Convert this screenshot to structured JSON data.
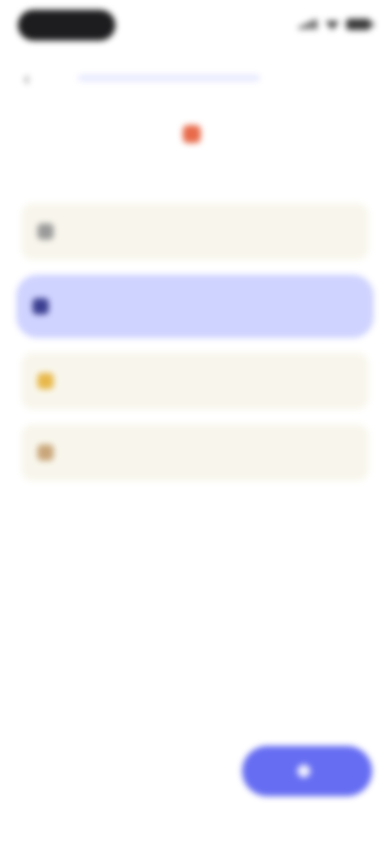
{
  "status_bar": {
    "icons": [
      "signal-icon",
      "wifi-icon",
      "battery-icon"
    ]
  },
  "nav": {
    "back_icon": "chevron-left-icon",
    "progress_fraction": 0.0
  },
  "question": {
    "line1": "",
    "line2": "",
    "icon": "emoji-icon"
  },
  "options": [
    {
      "label": "",
      "selected": false,
      "icon": "option-icon"
    },
    {
      "label": "",
      "selected": true,
      "icon": "option-icon"
    },
    {
      "label": "",
      "selected": false,
      "icon": "option-icon"
    },
    {
      "label": "",
      "selected": false,
      "icon": "option-icon"
    }
  ],
  "skip": {
    "label": ""
  },
  "continue_button": {
    "label": "",
    "icon": "arrow-icon"
  },
  "colors": {
    "accent": "#666df2",
    "selected_option": "#cfd3ff",
    "option_background": "#f8f6ec"
  }
}
